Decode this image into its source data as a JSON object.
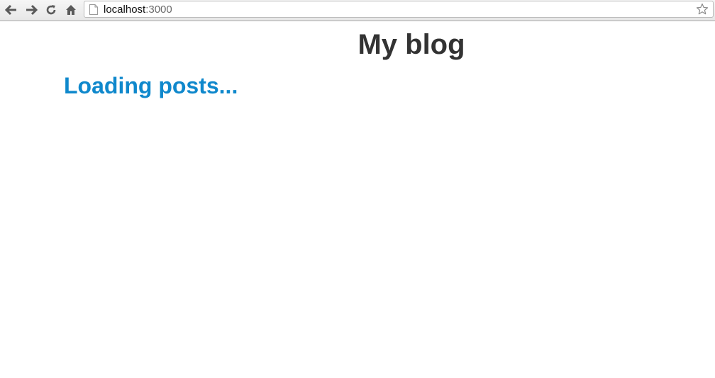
{
  "browser": {
    "url_host": "localhost",
    "url_port": ":3000",
    "icons": {
      "back": "back-arrow-icon",
      "forward": "forward-arrow-icon",
      "reload": "reload-icon",
      "home": "home-icon",
      "page": "page-icon",
      "bookmark": "star-icon"
    }
  },
  "page": {
    "title": "My blog",
    "status": "Loading posts..."
  },
  "colors": {
    "title": "#333333",
    "status": "#0f88cc"
  }
}
